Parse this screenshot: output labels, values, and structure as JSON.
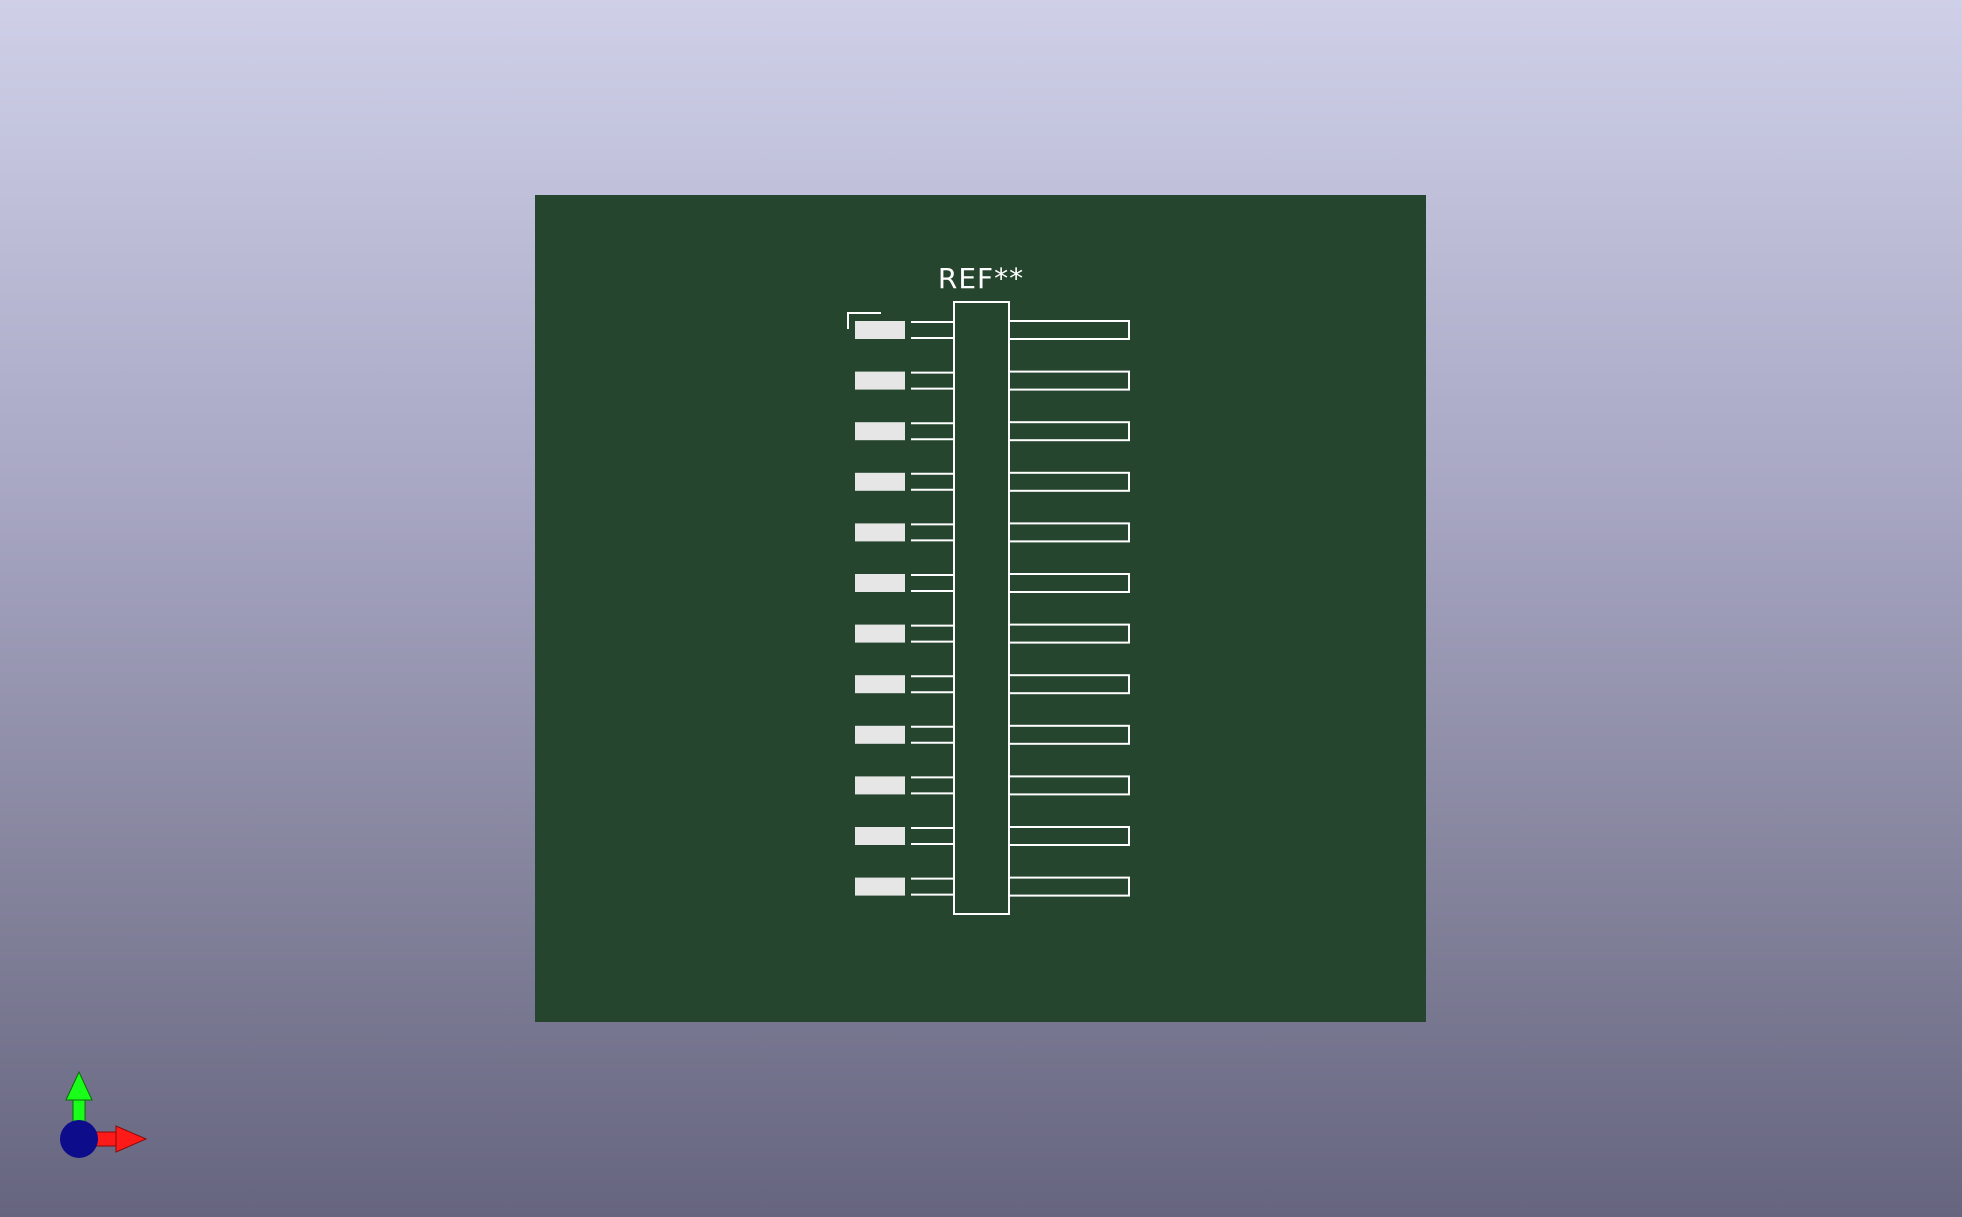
{
  "viewer": {
    "board_color": "#25452f",
    "silk_color": "#ffffff",
    "pad_color": "#e6e6e6"
  },
  "footprint": {
    "reference": "REF**",
    "pin_rows": 12
  },
  "axis_gizmo": {
    "x_color": "#ff1a1a",
    "y_color": "#1aff1a",
    "z_color": "#0d0d8c"
  }
}
